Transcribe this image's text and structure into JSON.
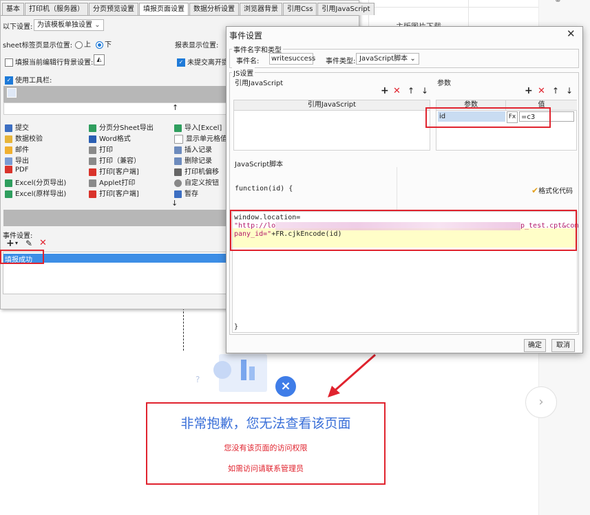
{
  "background": {
    "cell_text": "主版图片下载",
    "error": {
      "title": "非常抱歉，您无法查看该页面",
      "line1": "您没有该页面的访问权限",
      "line2": "如需访问请联系管理员"
    }
  },
  "left_panel": {
    "tabs": [
      "基本",
      "打印机（服务器）",
      "分页预览设置",
      "填报页面设置",
      "数据分析设置",
      "浏览器背景",
      "引用Css",
      "引用JavaScript"
    ],
    "active_tab_index": 3,
    "template_setting_label": "以下设置:",
    "template_setting_value": "为该模板单独设置",
    "sheet_tab_label": "sheet标签页显示位置:",
    "sheet_tab_top": "上",
    "sheet_tab_bottom": "下",
    "report_position_label": "报表显示位置:",
    "edit_row_bg_label": "填报当前编辑行背景设置:",
    "unsubmitted_label": "未提交离开提",
    "use_toolbar_label": "使用工具栏:",
    "toolbar_col1": [
      "提交",
      "数据校验",
      "邮件",
      "导出",
      "PDF",
      "Excel(分页导出)",
      "Excel(原样导出)"
    ],
    "toolbar_col2": [
      "分页分Sheet导出",
      "Word格式",
      "打印",
      "打印（兼容）",
      "打印[客户端]",
      "Applet打印",
      "打印[客户端]"
    ],
    "toolbar_col3": [
      "导入[Excel]",
      "显示单元格值",
      "插入记录",
      "删除记录",
      "打印机偏移",
      "自定义按钮",
      "暂存"
    ],
    "event_label": "事件设置:",
    "event_item": "填报成功"
  },
  "dialog": {
    "title": "事件设置",
    "name_type_legend": "事件名字和类型",
    "event_name_label": "事件名:",
    "event_name_value": "writesuccess",
    "event_type_label": "事件类型:",
    "event_type_value": "JavaScript脚本",
    "js_legend": "JS设置",
    "ref_js_label": "引用JavaScript",
    "param_label": "参数",
    "ref_js_header": "引用JavaScript",
    "param_col_header": "参数",
    "value_col_header": "值",
    "param_name": "id",
    "param_value": "=c3",
    "fx_label": "Fx",
    "script_legend": "JavaScript脚本",
    "function_sig": "function(id) {",
    "format_code_label": "格式化代码",
    "code_line1": "window.location=",
    "code_line2a": "\"http://lo",
    "code_line2b": "p_test.cpt&com",
    "code_line3": "pany_id=\"+FR.cjkEncode(id)",
    "closing_brace": "}",
    "ok_label": "确定",
    "cancel_label": "取消"
  },
  "colors": {
    "accent_red": "#e0232e",
    "select_blue": "#3d8ee6",
    "error_title_blue": "#3a6fd8",
    "error_text_red": "#e0232e"
  }
}
